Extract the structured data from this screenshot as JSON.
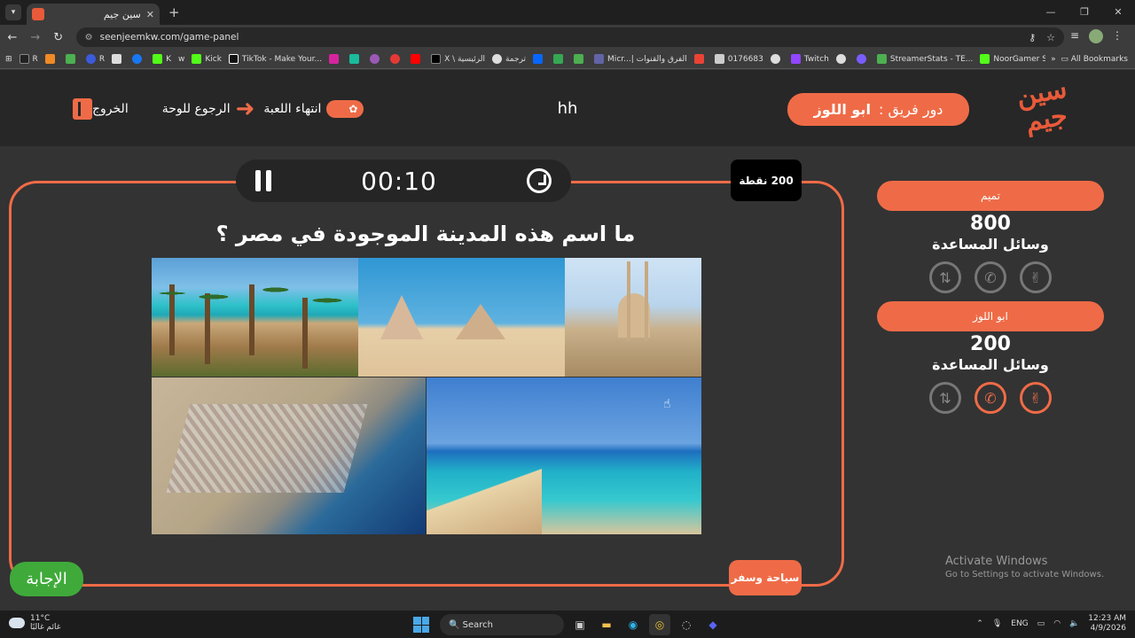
{
  "browser": {
    "tab_title": "سين جيم",
    "url": "seenjeemkw.com/game-panel",
    "bookmarks": [
      "R",
      "",
      "",
      "R",
      "",
      "",
      "K",
      "w",
      "Kick",
      "TikTok - Make Your...",
      "",
      "",
      "",
      "",
      "",
      "X \\ الرئيسية",
      "ترجمة",
      "",
      "",
      "",
      "Micr...| الفرق والقنوات",
      "0176683",
      "",
      "Twitch",
      "",
      "StreamerStats - TE...",
      "NoorGamer Stream..."
    ],
    "all_bookmarks": "All Bookmarks"
  },
  "header": {
    "logo": "سين جيم",
    "turn_prefix": "دور فريق :",
    "turn_team": "ابو اللوز",
    "center_title": "hh",
    "end_game": "انتهاء اللعبة",
    "back_to_board": "الرجوع للوحة",
    "exit": "الخروج"
  },
  "question": {
    "timer": "00:10",
    "points": "200 نقطة",
    "text": "ما اسم هذه المدينة الموجودة في مصر ؟",
    "answer_button": "الإجابة",
    "category": "سياحة وسفر"
  },
  "teams": [
    {
      "name": "تميم",
      "score": "800",
      "aids_label": "وسائل المساعدة",
      "aids": [
        {
          "icon": "two-answers-icon",
          "active": false
        },
        {
          "icon": "phone-icon",
          "active": false
        },
        {
          "icon": "swap-icon",
          "active": false
        }
      ]
    },
    {
      "name": "ابو اللوز",
      "score": "200",
      "aids_label": "وسائل المساعدة",
      "aids": [
        {
          "icon": "two-answers-icon",
          "active": true
        },
        {
          "icon": "phone-icon",
          "active": true
        },
        {
          "icon": "swap-icon",
          "active": false
        }
      ]
    }
  ],
  "watermark": {
    "line1": "Activate Windows",
    "line2": "Go to Settings to activate Windows."
  },
  "taskbar": {
    "temp": "11°C",
    "weather_text": "غائم غالبًا",
    "search": "Search",
    "lang": "ENG",
    "time": "12:23 AM",
    "date": "4/9/2026"
  },
  "colors": {
    "accent": "#ef6b47",
    "answer_green": "#3faa3a",
    "bg": "#333333"
  }
}
